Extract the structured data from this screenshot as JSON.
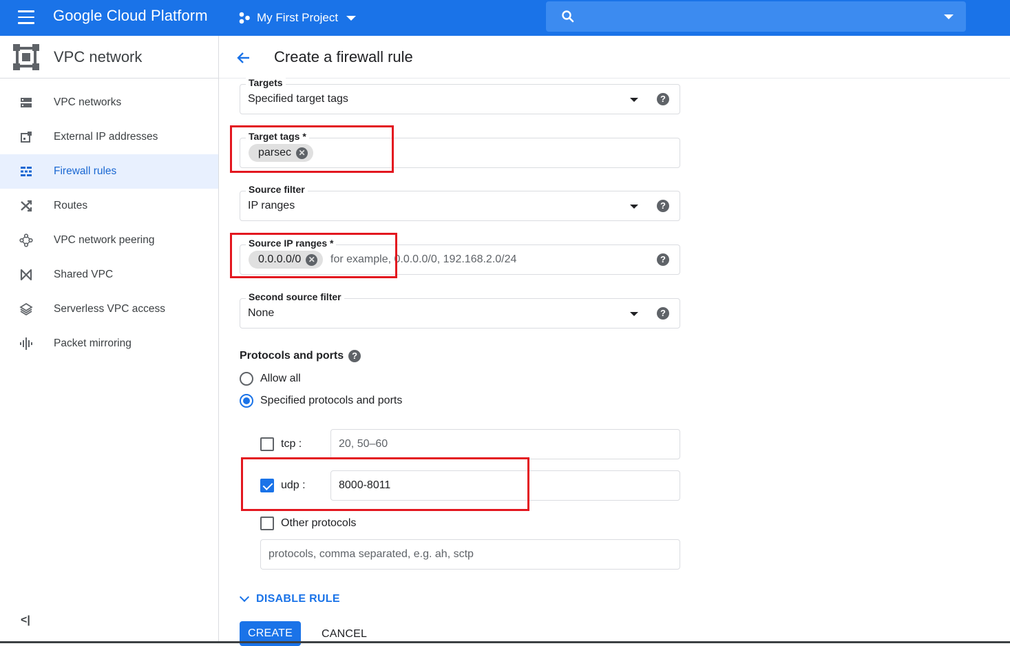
{
  "topbar": {
    "brand": "Google Cloud Platform",
    "project": "My First Project",
    "icons": [
      "menu-icon",
      "project-icon",
      "search-icon"
    ]
  },
  "sidebar": {
    "title": "VPC network",
    "items": [
      {
        "label": "VPC networks",
        "icon": "vpc-networks-icon"
      },
      {
        "label": "External IP addresses",
        "icon": "external-ip-icon"
      },
      {
        "label": "Firewall rules",
        "icon": "firewall-icon",
        "active": true
      },
      {
        "label": "Routes",
        "icon": "routes-icon"
      },
      {
        "label": "VPC network peering",
        "icon": "peering-icon"
      },
      {
        "label": "Shared VPC",
        "icon": "shared-vpc-icon"
      },
      {
        "label": "Serverless VPC access",
        "icon": "serverless-icon"
      },
      {
        "label": "Packet mirroring",
        "icon": "packet-mirroring-icon"
      }
    ],
    "collapse": "<|"
  },
  "main": {
    "title": "Create a firewall rule",
    "targets": {
      "label": "Targets",
      "value": "Specified target tags"
    },
    "target_tags": {
      "label": "Target tags *",
      "chip": "parsec"
    },
    "source_filter": {
      "label": "Source filter",
      "value": "IP ranges"
    },
    "source_ip_ranges": {
      "label": "Source IP ranges *",
      "chip": "0.0.0.0/0",
      "placeholder": "for example, 0.0.0.0/0, 192.168.2.0/24"
    },
    "second_source_filter": {
      "label": "Second source filter",
      "value": "None"
    },
    "protocols": {
      "title": "Protocols and ports",
      "allow_all": "Allow all",
      "specified": "Specified protocols and ports",
      "selected": "specified",
      "tcp": {
        "label": "tcp :",
        "checked": false,
        "placeholder": "20, 50–60"
      },
      "udp": {
        "label": "udp :",
        "checked": true,
        "value": "8000-8011"
      },
      "other": {
        "label": "Other protocols",
        "checked": false,
        "placeholder": "protocols, comma separated, e.g. ah, sctp"
      }
    },
    "disable_rule": "DISABLE RULE",
    "create": "CREATE",
    "cancel": "CANCEL"
  },
  "colors": {
    "accent": "#1a73e8",
    "highlight": "#e3171f",
    "active_bg": "#e8f0fe"
  }
}
